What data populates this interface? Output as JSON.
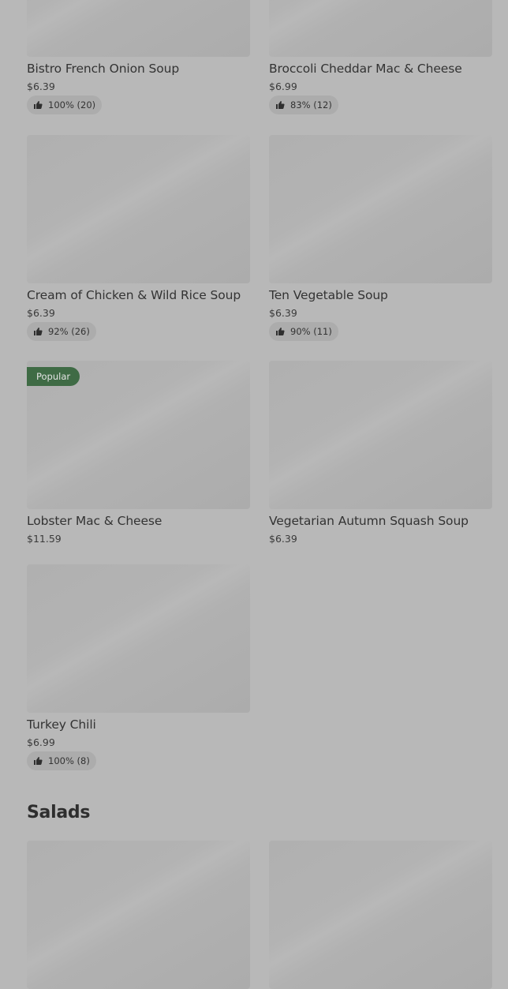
{
  "menu": {
    "items": [
      {
        "name": "Bistro French Onion Soup",
        "price": "$6.39",
        "rating": "100% (20)"
      },
      {
        "name": "Broccoli Cheddar Mac & Cheese",
        "price": "$6.99",
        "rating": "83% (12)"
      },
      {
        "name": "Cream of Chicken & Wild Rice Soup",
        "price": "$6.39",
        "rating": "92% (26)"
      },
      {
        "name": "Ten Vegetable Soup",
        "price": "$6.39",
        "rating": "90% (11)"
      },
      {
        "name": "Lobster Mac & Cheese",
        "price": "$11.59",
        "badge": "Popular"
      },
      {
        "name": "Vegetarian Autumn Squash Soup",
        "price": "$6.39"
      },
      {
        "name": "Turkey Chili",
        "price": "$6.99",
        "rating": "100% (8)"
      }
    ]
  },
  "next_section": {
    "title": "Salads"
  },
  "colors": {
    "background": "#b8b8b8",
    "image_placeholder": "#b2b2b2",
    "badge": "#3f6b45",
    "rating_pill": "#acacac"
  }
}
